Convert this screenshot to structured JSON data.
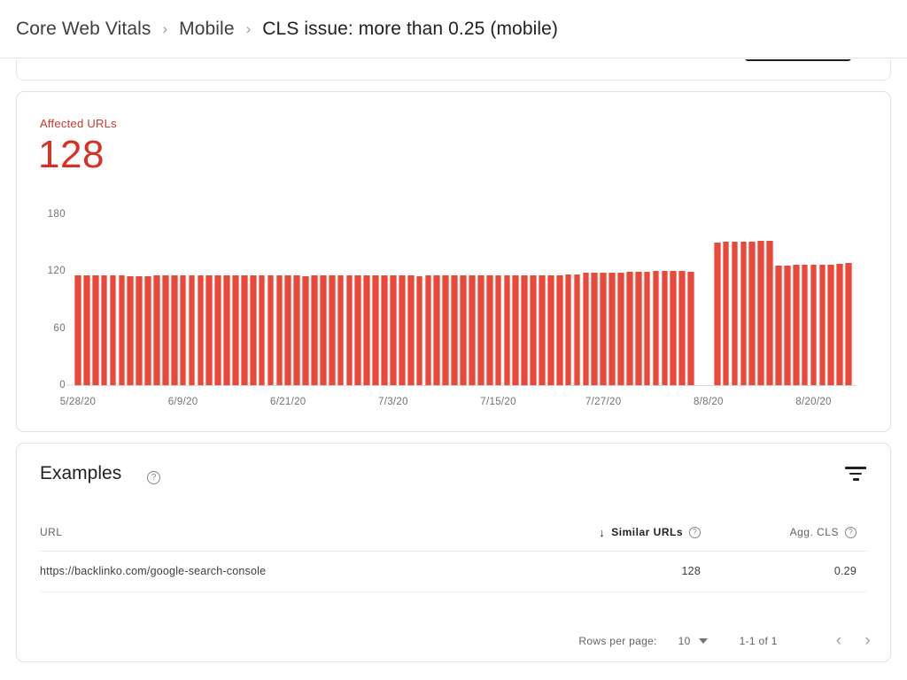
{
  "breadcrumb": {
    "items": [
      {
        "label": "Core Web Vitals",
        "current": false
      },
      {
        "label": "Mobile",
        "current": false
      },
      {
        "label": "CLS issue: more than 0.25 (mobile)",
        "current": true
      }
    ],
    "separator": "›"
  },
  "chart_card": {
    "metric_label": "Affected URLs",
    "metric_value": "128",
    "accent_color": "#d93025",
    "bar_color": "#e9483a"
  },
  "chart_data": {
    "type": "bar",
    "title": "Affected URLs",
    "xlabel": "",
    "ylabel": "",
    "ylim": [
      0,
      180
    ],
    "yticks": [
      0,
      60,
      120,
      180
    ],
    "ytick_labels": [
      "0",
      "60",
      "120",
      "180"
    ],
    "grid": false,
    "legend": null,
    "xtick_labels": [
      "5/28/20",
      "6/9/20",
      "6/21/20",
      "7/3/20",
      "7/15/20",
      "7/27/20",
      "8/8/20",
      "8/20/20"
    ],
    "xtick_indices": [
      0,
      12,
      24,
      36,
      48,
      60,
      72,
      84
    ],
    "x": [
      "5/28/20",
      "5/29/20",
      "5/30/20",
      "5/31/20",
      "6/1/20",
      "6/2/20",
      "6/3/20",
      "6/4/20",
      "6/5/20",
      "6/6/20",
      "6/7/20",
      "6/8/20",
      "6/9/20",
      "6/10/20",
      "6/11/20",
      "6/12/20",
      "6/13/20",
      "6/14/20",
      "6/15/20",
      "6/16/20",
      "6/17/20",
      "6/18/20",
      "6/19/20",
      "6/20/20",
      "6/21/20",
      "6/22/20",
      "6/23/20",
      "6/24/20",
      "6/25/20",
      "6/26/20",
      "6/27/20",
      "6/28/20",
      "6/29/20",
      "6/30/20",
      "7/1/20",
      "7/2/20",
      "7/3/20",
      "7/4/20",
      "7/5/20",
      "7/6/20",
      "7/7/20",
      "7/8/20",
      "7/9/20",
      "7/10/20",
      "7/11/20",
      "7/12/20",
      "7/13/20",
      "7/14/20",
      "7/15/20",
      "7/16/20",
      "7/17/20",
      "7/18/20",
      "7/19/20",
      "7/20/20",
      "7/21/20",
      "7/22/20",
      "7/23/20",
      "7/24/20",
      "7/25/20",
      "7/26/20",
      "7/27/20",
      "7/28/20",
      "7/29/20",
      "7/30/20",
      "7/31/20",
      "8/1/20",
      "8/2/20",
      "8/3/20",
      "8/4/20",
      "8/5/20",
      "8/6/20",
      "8/7/20",
      "8/8/20",
      "8/9/20",
      "8/10/20",
      "8/11/20",
      "8/12/20",
      "8/13/20",
      "8/14/20",
      "8/15/20",
      "8/16/20",
      "8/17/20",
      "8/18/20",
      "8/19/20",
      "8/20/20",
      "8/21/20",
      "8/22/20",
      "8/23/20",
      "8/24/20"
    ],
    "values": [
      116,
      116,
      116,
      116,
      116,
      116,
      115,
      115,
      115,
      116,
      116,
      116,
      116,
      116,
      116,
      116,
      116,
      116,
      116,
      116,
      116,
      116,
      116,
      116,
      116,
      116,
      115,
      116,
      116,
      116,
      116,
      116,
      116,
      116,
      116,
      116,
      116,
      116,
      116,
      115,
      116,
      116,
      116,
      116,
      116,
      116,
      116,
      116,
      116,
      116,
      116,
      116,
      116,
      116,
      116,
      116,
      117,
      117,
      118,
      118,
      118,
      118,
      118,
      119,
      119,
      119,
      120,
      120,
      120,
      120,
      119,
      null,
      null,
      150,
      151,
      151,
      151,
      151,
      152,
      152,
      126,
      126,
      127,
      127,
      127,
      127,
      127,
      128,
      129
    ]
  },
  "examples_card": {
    "title": "Examples",
    "help_icon": "help-circle-icon",
    "filter_icon": "filter-icon",
    "columns": [
      {
        "key": "url",
        "label": "URL",
        "sorted": false,
        "has_help": false
      },
      {
        "key": "similar",
        "label": "Similar URLs",
        "sorted": true,
        "sort_direction": "↓",
        "has_help": true
      },
      {
        "key": "agg",
        "label": "Agg. CLS",
        "sorted": false,
        "has_help": true
      }
    ],
    "rows": [
      {
        "url": "https://backlinko.com/google-search-console",
        "similar": "128",
        "agg": "0.29"
      }
    ],
    "pagination": {
      "rows_per_page_label": "Rows per page:",
      "rows_per_page_value": "10",
      "range": "1-1 of 1",
      "prev_icon": "‹",
      "next_icon": "›"
    }
  }
}
